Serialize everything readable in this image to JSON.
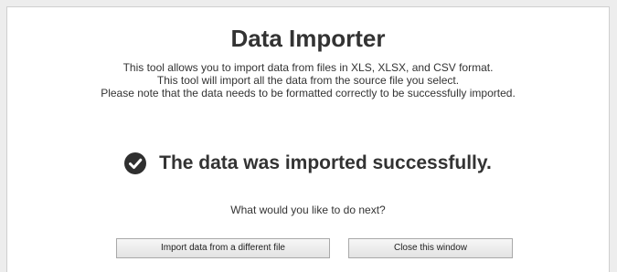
{
  "dialog": {
    "title": "Data Importer",
    "description_lines": [
      "This tool allows you to import data from files in XLS, XLSX, and CSV format.",
      "This tool will import all the data from the source file you select.",
      "Please note that the data needs to be formatted correctly to be successfully imported."
    ],
    "success_icon": "check-circle-icon",
    "success_message": "The data was imported successfully.",
    "next_prompt": "What would you like to do next?",
    "buttons": {
      "import_label": "Import data from a different file",
      "close_label": "Close this window"
    }
  },
  "colors": {
    "page_background": "#ededed",
    "panel_background": "#ffffff",
    "text": "#333333"
  }
}
